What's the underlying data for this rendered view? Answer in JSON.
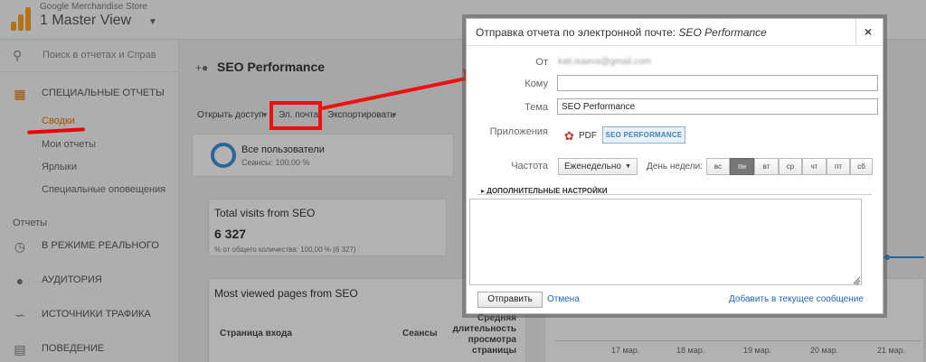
{
  "header": {
    "account_small": "Google Merchandise Store",
    "view_name": "1 Master View",
    "logo_icon": "analytics-logo-icon",
    "caret_icon": "caret-down-icon"
  },
  "sidebar": {
    "search_placeholder": "Поиск в отчетах и Справ",
    "custom_reports": "СПЕЦИАЛЬНЫЕ ОТЧЕТЫ",
    "sub_items": [
      "Сводки",
      "Мои отчеты",
      "Ярлыки",
      "Специальные оповещения"
    ],
    "section_reports": "Отчеты",
    "realtime": "В РЕЖИМЕ РЕАЛЬНОГО",
    "audience": "АУДИТОРИЯ",
    "traffic": "ИСТОЧНИКИ ТРАФИКА",
    "behavior": "ПОВЕДЕНИЕ"
  },
  "main": {
    "title": "SEO Performance",
    "toolbar": {
      "share": "Открыть доступ",
      "email": "Эл. почта",
      "export": "Экспортировать"
    },
    "segment": {
      "name": "Все пользователи",
      "sub": "Сеансы: 100,00 %"
    },
    "visits": {
      "title": "Total visits from SEO",
      "value": "6 327",
      "sub": "% от общего количества: 100,00 % (6 327)"
    },
    "pages": {
      "title": "Most viewed pages from SEO",
      "col1": "Страница входа",
      "col2": "Сеансы",
      "col3": "Средняя длительность просмотра страницы"
    },
    "chart_dates": [
      "17 мар.",
      "18 мар.",
      "19 мар.",
      "20 мар.",
      "21 мар."
    ]
  },
  "dialog": {
    "title_prefix": "Отправка отчета по электронной почте: ",
    "title_report": "SEO Performance",
    "close": "×",
    "from_label": "От",
    "from_value": "kati.isaeva@gmail.com",
    "to_label": "Кому",
    "to_value": "",
    "subject_label": "Тема",
    "subject_value": "SEO Performance",
    "attachments_label": "Приложения",
    "pdf_label": "PDF",
    "attachment_badge": "SEO PERFORMANCE",
    "frequency_label": "Частота",
    "frequency_value": "Еженедельно",
    "dow_label": "День недели:",
    "days": [
      "вс",
      "пн",
      "вт",
      "ср",
      "чт",
      "пт",
      "сб"
    ],
    "selected_day": "пн",
    "advanced": "ДОПОЛНИТЕЛЬНЫЕ НАСТРОЙКИ",
    "send": "Отправить",
    "cancel": "Отмена",
    "add_to_existing": "Добавить в текущее сообщение"
  },
  "colors": {
    "accent_orange": "#e37400",
    "highlight_red": "#ee1111",
    "link_blue": "#2266bb",
    "segment_blue": "#3a8fd8"
  }
}
